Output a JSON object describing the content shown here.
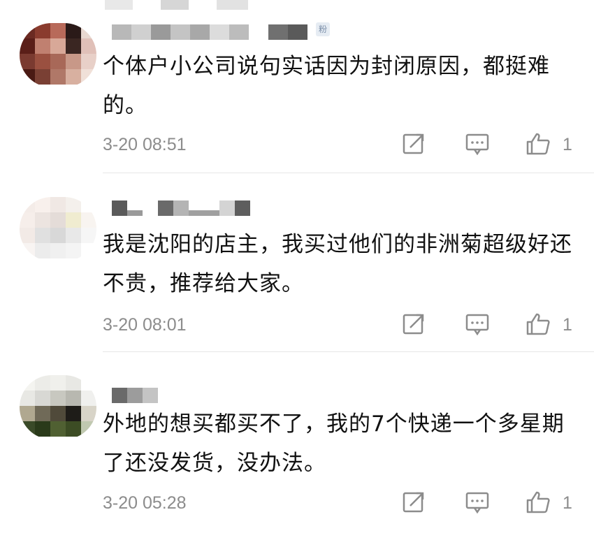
{
  "comments": [
    {
      "text": "个体户小公司说句实话因为封闭原因，都挺难的。",
      "time": "3-20 08:51",
      "likes": "1",
      "badge": "粉",
      "actions": {
        "repost_icon": "share-icon",
        "reply_icon": "comment-icon",
        "like_icon": "thumbs-up-icon"
      }
    },
    {
      "text": "我是沈阳的店主，我买过他们的非洲菊超级好还不贵，推荐给大家。",
      "time": "3-20 08:01",
      "likes": "1",
      "actions": {
        "repost_icon": "share-icon",
        "reply_icon": "comment-icon",
        "like_icon": "thumbs-up-icon"
      }
    },
    {
      "text": "外地的想买都买不了，我的7个快递一个多星期了还没发货，没办法。",
      "time": "3-20 05:28",
      "likes": "1",
      "actions": {
        "repost_icon": "share-icon",
        "reply_icon": "comment-icon",
        "like_icon": "thumbs-up-icon"
      }
    }
  ],
  "colors": {
    "text": "#111111",
    "meta": "#8c8c8c",
    "icon": "#8c8c8c",
    "divider": "#e6e6e6",
    "badge_bg": "#e6ecf3"
  }
}
